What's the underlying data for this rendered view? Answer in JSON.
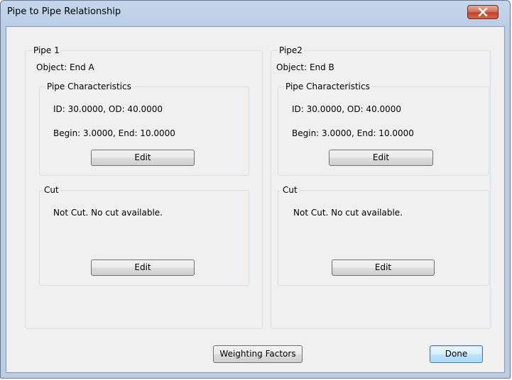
{
  "window": {
    "title": "Pipe to Pipe Relationship",
    "close_icon": "close-icon"
  },
  "pipe1": {
    "group_label": "Pipe 1",
    "object": "Object: End A",
    "characteristics": {
      "label": "Pipe Characteristics",
      "diameters": "ID: 30.0000, OD: 40.0000",
      "range": "Begin: 3.0000, End: 10.0000",
      "edit_label": "Edit"
    },
    "cut": {
      "label": "Cut",
      "status": "Not Cut. No cut available.",
      "edit_label": "Edit"
    }
  },
  "pipe2": {
    "group_label": "Pipe2",
    "object": "Object: End B",
    "characteristics": {
      "label": "Pipe Characteristics",
      "diameters": "ID: 30.0000, OD: 40.0000",
      "range": "Begin: 3.0000, End: 10.0000",
      "edit_label": "Edit"
    },
    "cut": {
      "label": "Cut",
      "status": "Not Cut. No cut available.",
      "edit_label": "Edit"
    }
  },
  "footer": {
    "weighting_label": "Weighting Factors",
    "done_label": "Done"
  }
}
